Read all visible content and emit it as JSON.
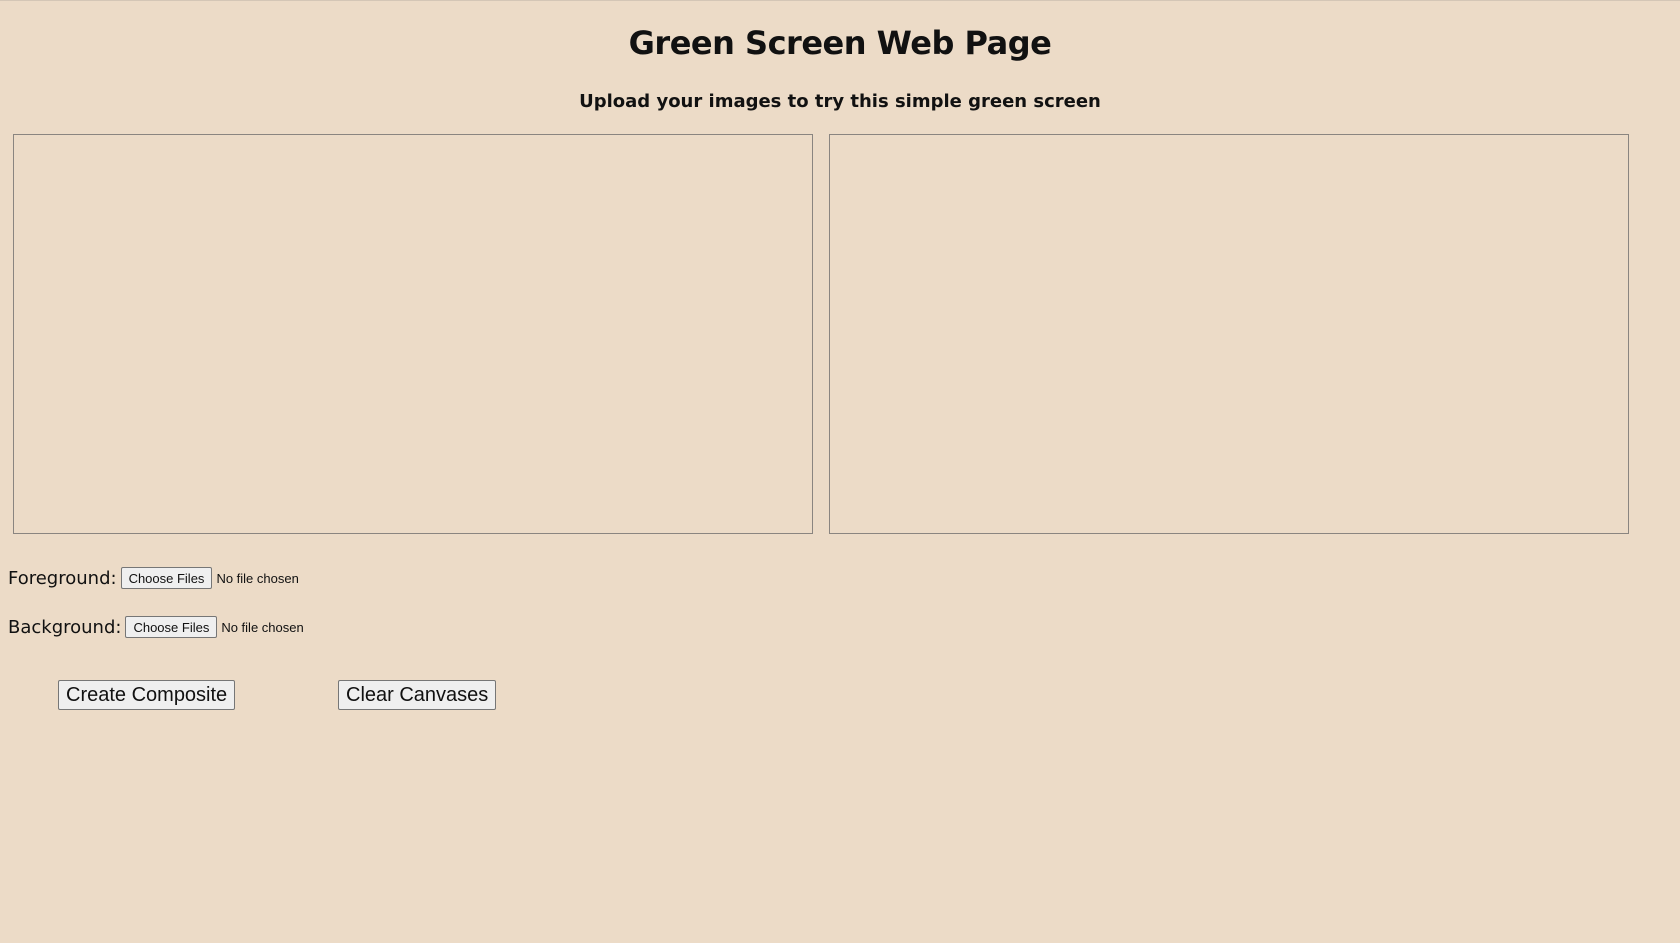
{
  "page": {
    "title": "Green Screen Web Page",
    "subtitle": "Upload your images to try this simple green screen"
  },
  "foreground": {
    "label": "Foreground:",
    "button_label": "Choose Files",
    "status": "No file chosen"
  },
  "background": {
    "label": "Background:",
    "button_label": "Choose Files",
    "status": "No file chosen"
  },
  "actions": {
    "create_label": "Create Composite",
    "clear_label": "Clear Canvases"
  },
  "colors": {
    "page_background": "#ecdbc7",
    "canvas_border": "#8a8580",
    "text": "#111111"
  }
}
